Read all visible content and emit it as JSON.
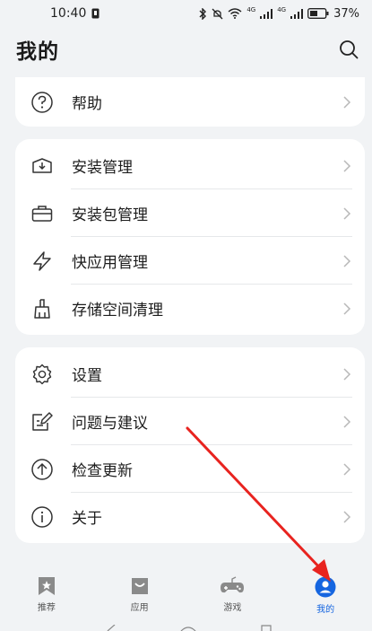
{
  "status_bar": {
    "time": "10:40",
    "battery": "37%",
    "net_1": "4G",
    "net_2": "4G"
  },
  "header": {
    "title": "我的"
  },
  "card1": {
    "items": [
      {
        "label": "帮助",
        "icon": "help-circle-icon"
      }
    ]
  },
  "card2": {
    "items": [
      {
        "label": "安装管理",
        "icon": "install-box-icon"
      },
      {
        "label": "安装包管理",
        "icon": "package-icon"
      },
      {
        "label": "快应用管理",
        "icon": "quick-app-icon"
      },
      {
        "label": "存储空间清理",
        "icon": "broom-icon"
      }
    ]
  },
  "card3": {
    "items": [
      {
        "label": "设置",
        "icon": "gear-icon"
      },
      {
        "label": "问题与建议",
        "icon": "feedback-icon"
      },
      {
        "label": "检查更新",
        "icon": "update-icon"
      },
      {
        "label": "关于",
        "icon": "info-icon"
      }
    ]
  },
  "bottom_nav": {
    "items": [
      {
        "label": "推荐",
        "icon": "recommend-icon"
      },
      {
        "label": "应用",
        "icon": "apps-bag-icon"
      },
      {
        "label": "游戏",
        "icon": "gamepad-icon"
      },
      {
        "label": "我的",
        "icon": "profile-icon",
        "active": true
      }
    ]
  },
  "colors": {
    "accent": "#1565e0",
    "annotation_arrow": "#e8231f",
    "background": "#f1f3f5"
  }
}
